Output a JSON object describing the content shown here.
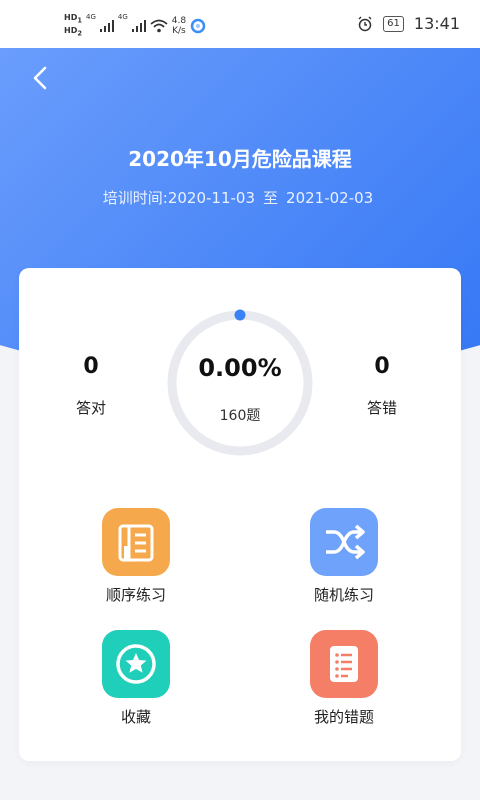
{
  "status_bar": {
    "hd1": "HD",
    "hd1_sub": "1",
    "hd2": "HD",
    "hd2_sub": "2",
    "net1": "4G",
    "net2": "4G",
    "speed_value": "4.8",
    "speed_unit": "K/s",
    "battery": "61",
    "time": "13:41"
  },
  "header": {
    "title": "2020年10月危险品课程",
    "time_label": "培训时间:",
    "start_date": "2020-11-03",
    "separator": "至",
    "end_date": "2021-02-03"
  },
  "stats": {
    "correct_count": "0",
    "correct_label": "答对",
    "wrong_count": "0",
    "wrong_label": "答错",
    "progress_text": "0.00%",
    "progress_fraction": 0,
    "total_questions": "160题"
  },
  "actions": [
    {
      "label": "顺序练习",
      "icon": "ordered-list-icon",
      "color": "#f5a94c"
    },
    {
      "label": "随机练习",
      "icon": "shuffle-icon",
      "color": "#6ea2fb"
    },
    {
      "label": "收藏",
      "icon": "star-icon",
      "color": "#1fcfb9"
    },
    {
      "label": "我的错题",
      "icon": "error-list-icon",
      "color": "#f47e66"
    }
  ],
  "colors": {
    "header_gradient_start": "#6a9dfc",
    "header_gradient_end": "#3577f5",
    "ring_track": "#e8eaef",
    "ring_dot": "#3b82f6"
  }
}
